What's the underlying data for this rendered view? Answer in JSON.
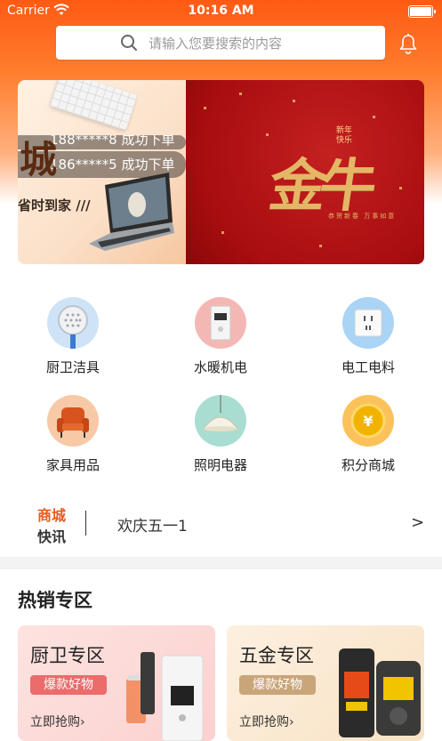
{
  "status": {
    "carrier": "Carrier",
    "time": "10:16 AM"
  },
  "search": {
    "placeholder": "请输入您要搜索的内容"
  },
  "banner": {
    "big_char": "城",
    "ticker_1": "188*****8 成功下单",
    "ticker_2": "186*****5 成功下单",
    "promo": "省时到家 ///",
    "new_year": "新年快乐",
    "callig": "金牛",
    "callig_sub": "恭贺新春 万事如意"
  },
  "categories": [
    {
      "label": "厨卫洁具",
      "icon": "shower-head-icon"
    },
    {
      "label": "水暖机电",
      "icon": "water-heater-icon"
    },
    {
      "label": "电工电料",
      "icon": "power-socket-icon"
    },
    {
      "label": "家具用品",
      "icon": "armchair-icon"
    },
    {
      "label": "照明电器",
      "icon": "pendant-lamp-icon"
    },
    {
      "label": "积分商城",
      "icon": "coin-icon"
    }
  ],
  "news": {
    "brand_line1": "商城",
    "brand_line2": "快讯",
    "text": "欢庆五一1",
    "arrow": ">"
  },
  "hot": {
    "title": "热销专区",
    "cards": [
      {
        "title": "厨卫专区",
        "badge": "爆款好物",
        "action": "立即抢购›"
      },
      {
        "title": "五金专区",
        "badge": "爆款好物",
        "action": "立即抢购›"
      }
    ]
  },
  "colors": {
    "primary": "#ff5a14",
    "badge_red": "#ec6b6b",
    "badge_gold": "#c9a57a"
  }
}
